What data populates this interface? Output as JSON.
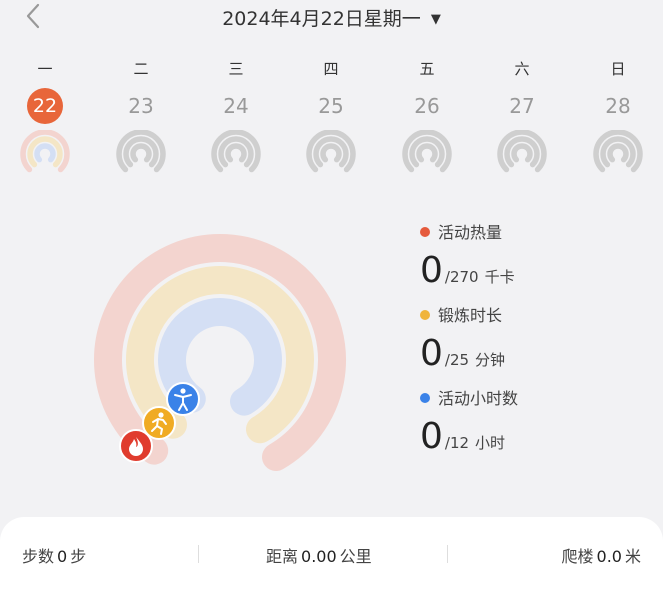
{
  "header": {
    "date_title": "2024年4月22日星期一",
    "back_icon": "chevron-left-icon",
    "dropdown_icon": "caret-down-icon"
  },
  "week": {
    "days": [
      {
        "weekday": "一",
        "date": "22",
        "selected": true
      },
      {
        "weekday": "二",
        "date": "23",
        "selected": false
      },
      {
        "weekday": "三",
        "date": "24",
        "selected": false
      },
      {
        "weekday": "四",
        "date": "25",
        "selected": false
      },
      {
        "weekday": "五",
        "date": "26",
        "selected": false
      },
      {
        "weekday": "六",
        "date": "27",
        "selected": false
      },
      {
        "weekday": "日",
        "date": "28",
        "selected": false
      }
    ]
  },
  "rings": {
    "calories": {
      "label": "活动热量",
      "current": "0",
      "total": "/270",
      "unit": "千卡",
      "color": "#e55a3c",
      "progress": 0,
      "icon": "flame-icon"
    },
    "exercise": {
      "label": "锻炼时长",
      "current": "0",
      "total": "/25",
      "unit": "分钟",
      "color": "#f0b43c",
      "progress": 0,
      "icon": "running-icon"
    },
    "stand": {
      "label": "活动小时数",
      "current": "0",
      "total": "/12",
      "unit": "小时",
      "color": "#3a82e8",
      "progress": 0,
      "icon": "standing-person-icon"
    }
  },
  "bottom": {
    "steps": {
      "label": "步数",
      "value": "0",
      "unit": "步"
    },
    "distance": {
      "label": "距离",
      "value": "0.00",
      "unit": "公里"
    },
    "floors": {
      "label": "爬楼",
      "value": "0.0",
      "unit": "米"
    }
  },
  "colors": {
    "accent": "#e8663a",
    "calories_track": "#f3d4cf",
    "exercise_track": "#f4e6c6",
    "stand_track": "#d4dff4",
    "inactive_ring": "#cfcfcf"
  }
}
